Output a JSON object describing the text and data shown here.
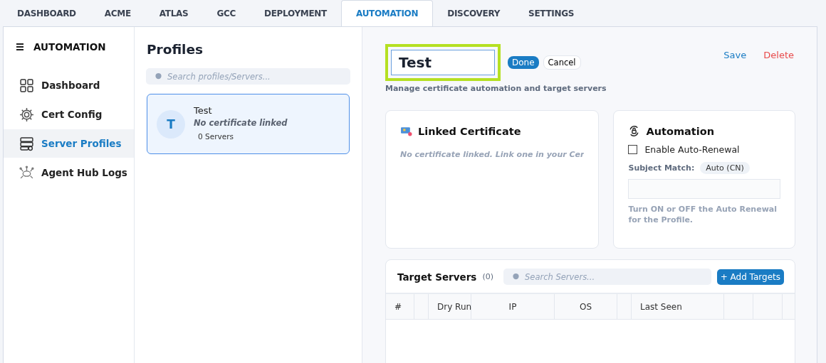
{
  "tabs": [
    {
      "label": "DASHBOARD",
      "selected": false
    },
    {
      "label": "ACME",
      "selected": false
    },
    {
      "label": "ATLAS",
      "selected": false
    },
    {
      "label": "GCC",
      "selected": false
    },
    {
      "label": "DEPLOYMENT",
      "selected": false
    },
    {
      "label": "AUTOMATION",
      "selected": true
    },
    {
      "label": "DISCOVERY",
      "selected": false
    },
    {
      "label": "SETTINGS",
      "selected": false
    }
  ],
  "sidebar": {
    "title": "AUTOMATION",
    "items": [
      {
        "label": "Dashboard",
        "kind": "grid",
        "selected": false
      },
      {
        "label": "Cert Config",
        "kind": "gear",
        "selected": false
      },
      {
        "label": "Server Profiles",
        "kind": "server",
        "selected": true
      },
      {
        "label": "Agent Hub Logs",
        "kind": "network",
        "selected": false
      }
    ]
  },
  "profiles": {
    "title": "Profiles",
    "search": {
      "placeholder": "Search profiles/Servers..."
    },
    "items": [
      {
        "initial": "T",
        "name": "Test",
        "certificate": "No certificate linked",
        "servers": "0 Servers",
        "selected": true
      }
    ]
  },
  "editor": {
    "name_field": {
      "value": "Test"
    },
    "done": "Done",
    "cancel": "Cancel",
    "subtitle": "Manage certificate automation and target servers",
    "save": "Save",
    "delete": "Delete",
    "linked_certificate": {
      "title": "Linked Certificate",
      "message": "No certificate linked. Link one in your Cer"
    },
    "automation": {
      "title": "Automation",
      "auto_renewal": {
        "label": "Enable Auto-Renewal",
        "checked": false
      },
      "subject_label": "Subject Match:",
      "subject_value": "Auto (CN)",
      "hint": "Turn ON or OFF the Auto Renewal for the Profile."
    },
    "target_servers": {
      "title": "Target Servers",
      "count": "(0)",
      "search": {
        "placeholder": "Search Servers..."
      },
      "add": "+ Add Targets",
      "columns": [
        {
          "label": "#"
        },
        {},
        {
          "label": "Dry Run"
        },
        {
          "label": "IP"
        },
        {
          "label": "OS"
        },
        {},
        {
          "label": "Last Seen"
        },
        {},
        {}
      ]
    }
  }
}
